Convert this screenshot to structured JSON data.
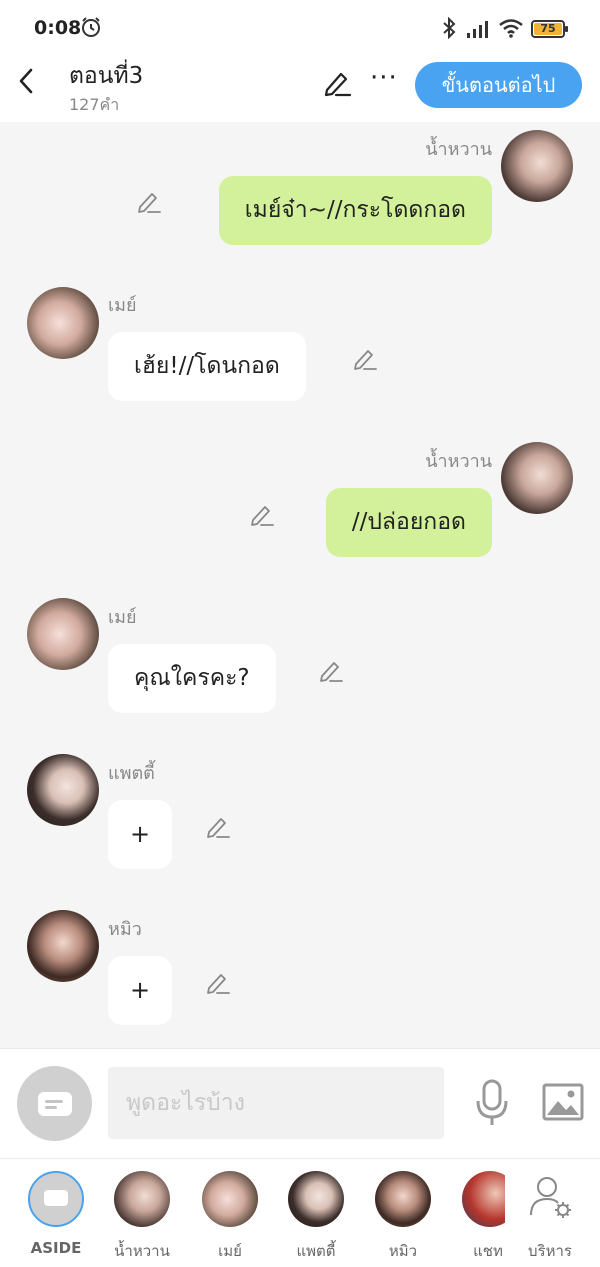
{
  "status_bar": {
    "time": "0:08",
    "battery": "75"
  },
  "header": {
    "title": "ตอนที่3",
    "word_count": "127คำ",
    "next_button": "ขั้นตอนต่อไป"
  },
  "messages": [
    {
      "side": "right",
      "sender": "น้ำหวาน",
      "text": "เมย์จ๋า~//กระโดดกอด",
      "avatar": "namwan"
    },
    {
      "side": "left",
      "sender": "เมย์",
      "text": "เฮ้ย!//โดนกอด",
      "avatar": "mei"
    },
    {
      "side": "right",
      "sender": "น้ำหวาน",
      "text": "//ปล่อยกอด",
      "avatar": "namwan"
    },
    {
      "side": "left",
      "sender": "เมย์",
      "text": "คุณใครคะ?",
      "avatar": "mei"
    },
    {
      "side": "left",
      "sender": "แพตตี้",
      "text": "+",
      "avatar": "party"
    },
    {
      "side": "left",
      "sender": "หมิว",
      "text": "+",
      "avatar": "miw"
    }
  ],
  "input": {
    "placeholder": "พูดอะไรบ้าง"
  },
  "characters": [
    {
      "label": "ASIDE"
    },
    {
      "label": "น้ำหวาน"
    },
    {
      "label": "เมย์"
    },
    {
      "label": "แพตตี้"
    },
    {
      "label": "หมิว"
    },
    {
      "label": "แชท"
    },
    {
      "label": "บริหาร"
    }
  ]
}
